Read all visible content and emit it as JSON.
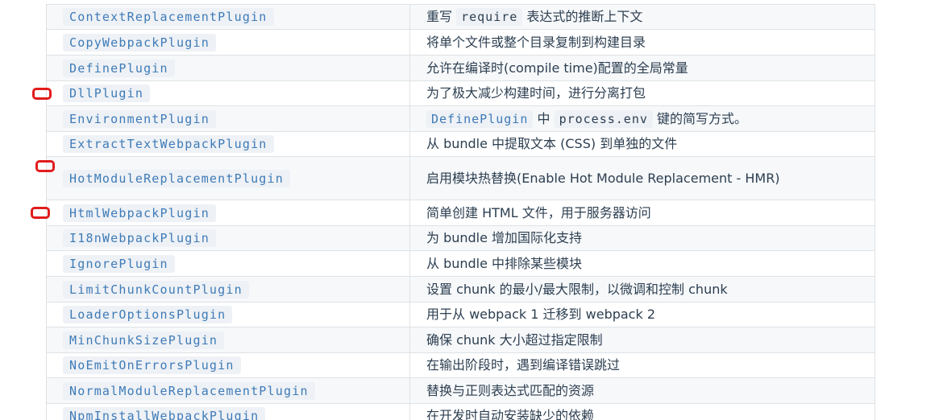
{
  "rows": [
    {
      "name": "ContextReplacementPlugin",
      "desc_parts": [
        {
          "t": "重写 "
        },
        {
          "code": "require"
        },
        {
          "t": " 表达式的推断上下文"
        }
      ]
    },
    {
      "name": "CopyWebpackPlugin",
      "desc": "将单个文件或整个目录复制到构建目录"
    },
    {
      "name": "DefinePlugin",
      "desc": "允许在编译时(compile time)配置的全局常量"
    },
    {
      "name": "DllPlugin",
      "desc": "为了极大减少构建时间，进行分离打包",
      "marked": true
    },
    {
      "name": "EnvironmentPlugin",
      "desc_parts": [
        {
          "code": "DefinePlugin",
          "blue": true
        },
        {
          "t": " 中 "
        },
        {
          "code": "process.env"
        },
        {
          "t": " 键的简写方式。"
        }
      ]
    },
    {
      "name": "ExtractTextWebpackPlugin",
      "desc": "从 bundle 中提取文本 (CSS) 到单独的文件"
    },
    {
      "name": "HotModuleReplacementPlugin",
      "desc": "启用模块热替换(Enable Hot Module Replacement - HMR)",
      "marked": true,
      "tall": true
    },
    {
      "name": "HtmlWebpackPlugin",
      "desc": "简单创建 HTML 文件，用于服务器访问",
      "marked": true
    },
    {
      "name": "I18nWebpackPlugin",
      "desc": "为 bundle 增加国际化支持"
    },
    {
      "name": "IgnorePlugin",
      "desc": "从 bundle 中排除某些模块"
    },
    {
      "name": "LimitChunkCountPlugin",
      "desc": "设置 chunk 的最小/最大限制，以微调和控制 chunk"
    },
    {
      "name": "LoaderOptionsPlugin",
      "desc": "用于从 webpack 1 迁移到 webpack 2"
    },
    {
      "name": "MinChunkSizePlugin",
      "desc": "确保 chunk 大小超过指定限制"
    },
    {
      "name": "NoEmitOnErrorsPlugin",
      "desc": "在输出阶段时，遇到编译错误跳过"
    },
    {
      "name": "NormalModuleReplacementPlugin",
      "desc": "替换与正则表达式匹配的资源"
    },
    {
      "name": "NpmInstallWebpackPlugin",
      "desc": "在开发时自动安装缺少的依赖"
    }
  ],
  "colors": {
    "code_text": "#3e7bb8",
    "marker": "#e11c1c",
    "border": "#dfe2e5",
    "stripe": "#f6f8fa"
  }
}
